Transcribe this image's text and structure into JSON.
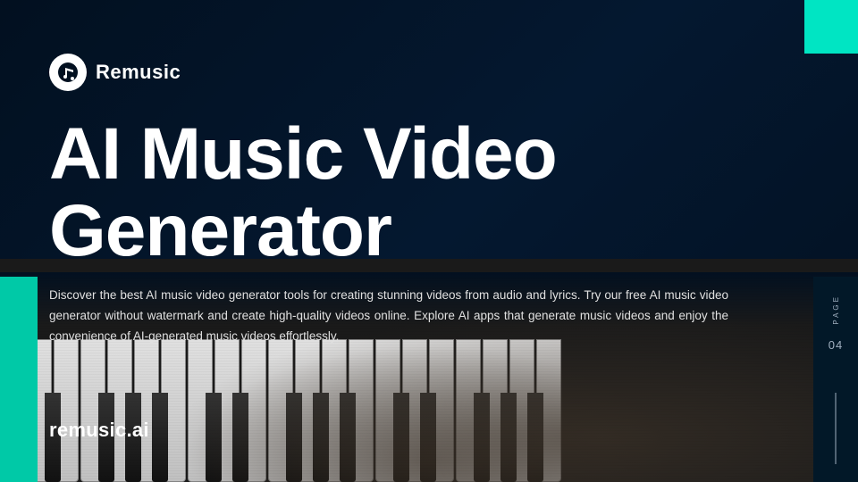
{
  "brand": {
    "logo_alt": "Remusic logo",
    "logo_icon": "music-note",
    "name": "Remusic"
  },
  "header": {
    "title": "AI Music Video Generator"
  },
  "description": {
    "text": "Discover the best AI music video generator tools for creating stunning videos from audio and lyrics. Try our free AI music video generator without watermark and create high-quality videos online. Explore AI apps that generate music videos and enjoy the convenience of AI-generated music videos effortlessly."
  },
  "website": {
    "url": "remusic.ai"
  },
  "page_indicator": {
    "label": "PAGE",
    "number": "04"
  },
  "colors": {
    "background": "#021020",
    "teal_accent": "#00e5c3",
    "left_bar": "#00c9a7",
    "text_white": "#ffffff",
    "text_muted": "#a0b0c0"
  }
}
